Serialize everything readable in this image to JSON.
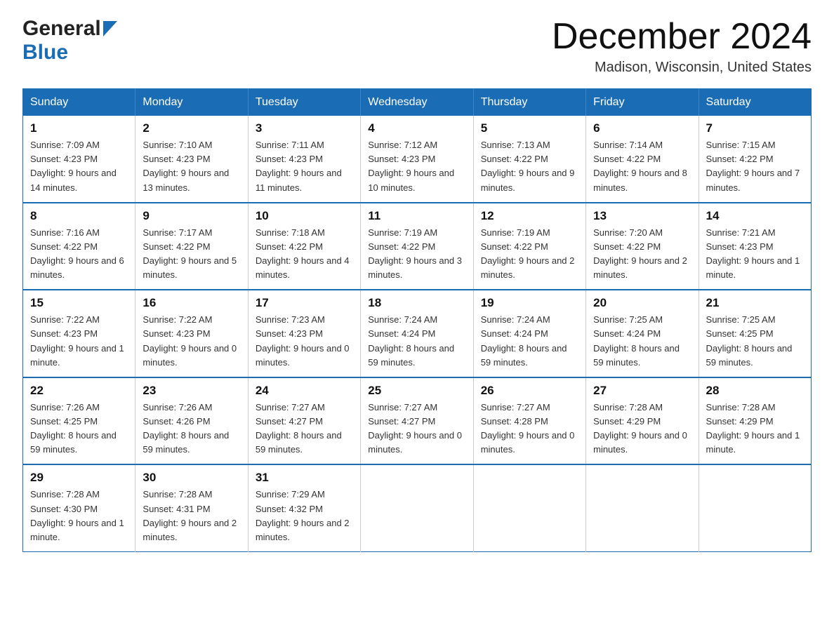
{
  "logo": {
    "general": "General",
    "blue": "Blue"
  },
  "header": {
    "title": "December 2024",
    "subtitle": "Madison, Wisconsin, United States"
  },
  "days_of_week": [
    "Sunday",
    "Monday",
    "Tuesday",
    "Wednesday",
    "Thursday",
    "Friday",
    "Saturday"
  ],
  "weeks": [
    [
      {
        "day": "1",
        "sunrise": "7:09 AM",
        "sunset": "4:23 PM",
        "daylight": "9 hours and 14 minutes."
      },
      {
        "day": "2",
        "sunrise": "7:10 AM",
        "sunset": "4:23 PM",
        "daylight": "9 hours and 13 minutes."
      },
      {
        "day": "3",
        "sunrise": "7:11 AM",
        "sunset": "4:23 PM",
        "daylight": "9 hours and 11 minutes."
      },
      {
        "day": "4",
        "sunrise": "7:12 AM",
        "sunset": "4:23 PM",
        "daylight": "9 hours and 10 minutes."
      },
      {
        "day": "5",
        "sunrise": "7:13 AM",
        "sunset": "4:22 PM",
        "daylight": "9 hours and 9 minutes."
      },
      {
        "day": "6",
        "sunrise": "7:14 AM",
        "sunset": "4:22 PM",
        "daylight": "9 hours and 8 minutes."
      },
      {
        "day": "7",
        "sunrise": "7:15 AM",
        "sunset": "4:22 PM",
        "daylight": "9 hours and 7 minutes."
      }
    ],
    [
      {
        "day": "8",
        "sunrise": "7:16 AM",
        "sunset": "4:22 PM",
        "daylight": "9 hours and 6 minutes."
      },
      {
        "day": "9",
        "sunrise": "7:17 AM",
        "sunset": "4:22 PM",
        "daylight": "9 hours and 5 minutes."
      },
      {
        "day": "10",
        "sunrise": "7:18 AM",
        "sunset": "4:22 PM",
        "daylight": "9 hours and 4 minutes."
      },
      {
        "day": "11",
        "sunrise": "7:19 AM",
        "sunset": "4:22 PM",
        "daylight": "9 hours and 3 minutes."
      },
      {
        "day": "12",
        "sunrise": "7:19 AM",
        "sunset": "4:22 PM",
        "daylight": "9 hours and 2 minutes."
      },
      {
        "day": "13",
        "sunrise": "7:20 AM",
        "sunset": "4:22 PM",
        "daylight": "9 hours and 2 minutes."
      },
      {
        "day": "14",
        "sunrise": "7:21 AM",
        "sunset": "4:23 PM",
        "daylight": "9 hours and 1 minute."
      }
    ],
    [
      {
        "day": "15",
        "sunrise": "7:22 AM",
        "sunset": "4:23 PM",
        "daylight": "9 hours and 1 minute."
      },
      {
        "day": "16",
        "sunrise": "7:22 AM",
        "sunset": "4:23 PM",
        "daylight": "9 hours and 0 minutes."
      },
      {
        "day": "17",
        "sunrise": "7:23 AM",
        "sunset": "4:23 PM",
        "daylight": "9 hours and 0 minutes."
      },
      {
        "day": "18",
        "sunrise": "7:24 AM",
        "sunset": "4:24 PM",
        "daylight": "8 hours and 59 minutes."
      },
      {
        "day": "19",
        "sunrise": "7:24 AM",
        "sunset": "4:24 PM",
        "daylight": "8 hours and 59 minutes."
      },
      {
        "day": "20",
        "sunrise": "7:25 AM",
        "sunset": "4:24 PM",
        "daylight": "8 hours and 59 minutes."
      },
      {
        "day": "21",
        "sunrise": "7:25 AM",
        "sunset": "4:25 PM",
        "daylight": "8 hours and 59 minutes."
      }
    ],
    [
      {
        "day": "22",
        "sunrise": "7:26 AM",
        "sunset": "4:25 PM",
        "daylight": "8 hours and 59 minutes."
      },
      {
        "day": "23",
        "sunrise": "7:26 AM",
        "sunset": "4:26 PM",
        "daylight": "8 hours and 59 minutes."
      },
      {
        "day": "24",
        "sunrise": "7:27 AM",
        "sunset": "4:27 PM",
        "daylight": "8 hours and 59 minutes."
      },
      {
        "day": "25",
        "sunrise": "7:27 AM",
        "sunset": "4:27 PM",
        "daylight": "9 hours and 0 minutes."
      },
      {
        "day": "26",
        "sunrise": "7:27 AM",
        "sunset": "4:28 PM",
        "daylight": "9 hours and 0 minutes."
      },
      {
        "day": "27",
        "sunrise": "7:28 AM",
        "sunset": "4:29 PM",
        "daylight": "9 hours and 0 minutes."
      },
      {
        "day": "28",
        "sunrise": "7:28 AM",
        "sunset": "4:29 PM",
        "daylight": "9 hours and 1 minute."
      }
    ],
    [
      {
        "day": "29",
        "sunrise": "7:28 AM",
        "sunset": "4:30 PM",
        "daylight": "9 hours and 1 minute."
      },
      {
        "day": "30",
        "sunrise": "7:28 AM",
        "sunset": "4:31 PM",
        "daylight": "9 hours and 2 minutes."
      },
      {
        "day": "31",
        "sunrise": "7:29 AM",
        "sunset": "4:32 PM",
        "daylight": "9 hours and 2 minutes."
      },
      null,
      null,
      null,
      null
    ]
  ]
}
